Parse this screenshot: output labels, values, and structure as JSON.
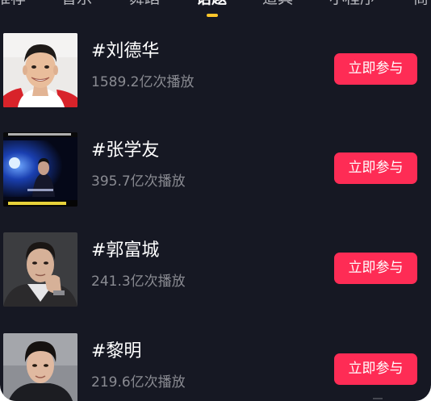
{
  "tabs": [
    {
      "label": "推荐",
      "active": false
    },
    {
      "label": "音乐",
      "active": false
    },
    {
      "label": "舞蹈",
      "active": false
    },
    {
      "label": "话题",
      "active": true
    },
    {
      "label": "道具",
      "active": false
    },
    {
      "label": "小程序",
      "active": false
    },
    {
      "label": "商",
      "active": false
    }
  ],
  "topics": [
    {
      "name": "#刘德华",
      "plays": "1589.2亿次播放",
      "button": "立即参与",
      "thumbnail": "portrait-smiling-man-red-collar"
    },
    {
      "name": "#张学友",
      "plays": "395.7亿次播放",
      "button": "立即参与",
      "thumbnail": "concert-stage-blue-lights"
    },
    {
      "name": "#郭富城",
      "plays": "241.3亿次播放",
      "button": "立即参与",
      "thumbnail": "portrait-man-hand-on-chin"
    },
    {
      "name": "#黎明",
      "plays": "219.6亿次播放",
      "button": "立即参与",
      "thumbnail": "portrait-man-dark-shirt"
    }
  ],
  "colors": {
    "background": "#161823",
    "button": "#fe2c55",
    "tab_indicator": "#fdc62b",
    "secondary_text": "#8a8b92"
  }
}
